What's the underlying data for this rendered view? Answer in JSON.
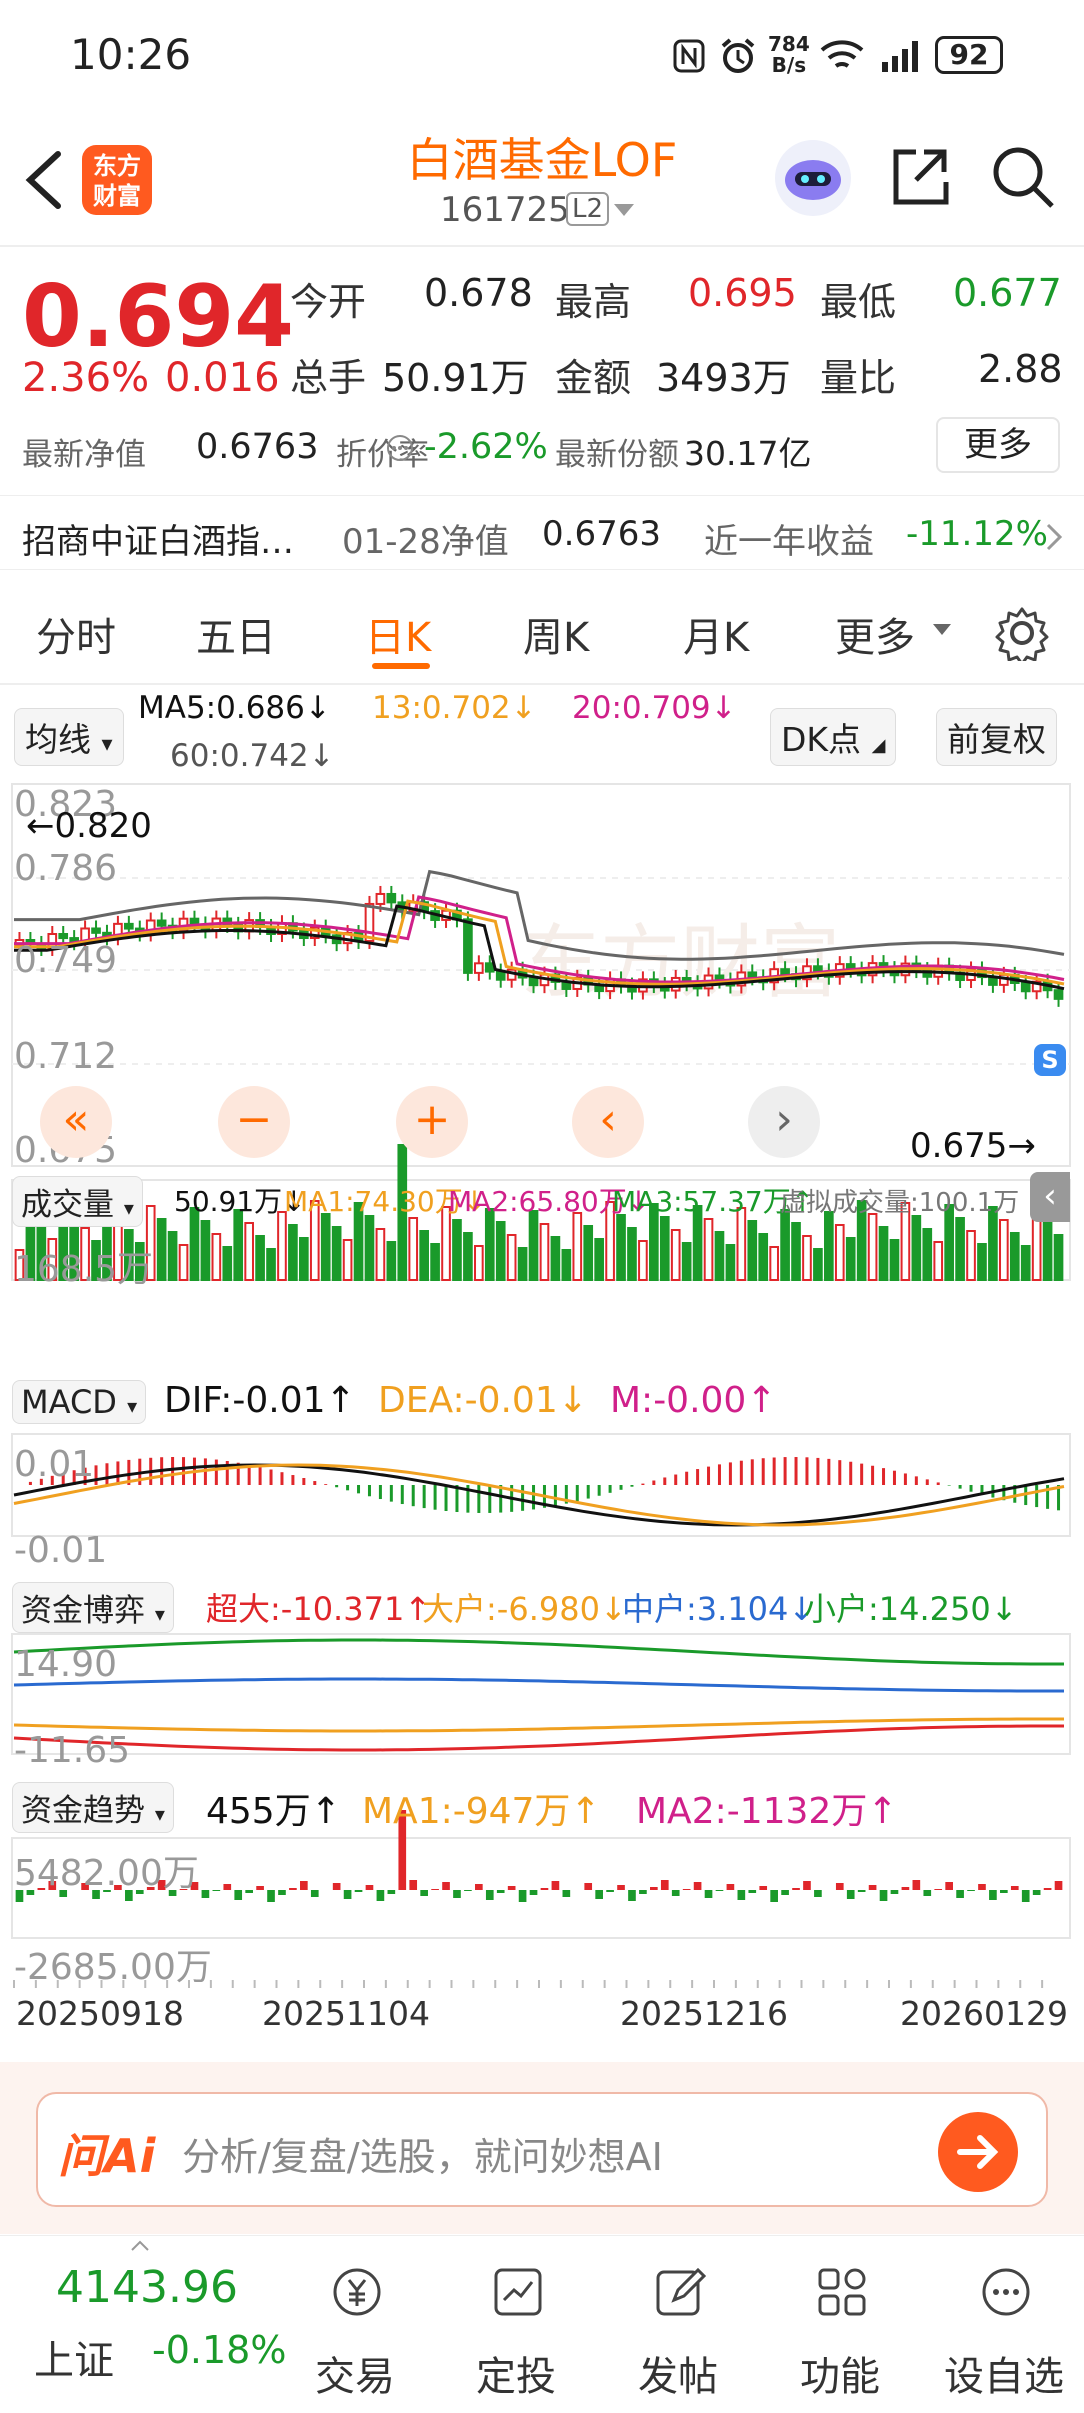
{
  "status": {
    "time": "10:26",
    "net_speed_top": "784",
    "net_speed_bottom": "B/s",
    "battery": "92"
  },
  "header": {
    "logo_line1": "东方",
    "logo_line2": "财富",
    "title": "白酒基金LOF",
    "code": "161725",
    "level": "L2"
  },
  "quote": {
    "price": "0.694",
    "change_pct": "2.36%",
    "change": "0.016",
    "open_label": "今开",
    "open": "0.678",
    "high_label": "最高",
    "high": "0.695",
    "low_label": "最低",
    "low": "0.677",
    "volume_label": "总手",
    "volume": "50.91万",
    "amount_label": "金额",
    "amount": "3493万",
    "ratio_label": "量比",
    "ratio": "2.88",
    "nav_label": "最新净值",
    "nav": "0.6763",
    "discount_label": "折价率",
    "discount": "-2.62%",
    "shares_label": "最新份额",
    "shares": "30.17亿",
    "more": "更多"
  },
  "fundinfo": {
    "name": "招商中证白酒指…",
    "date_nav_label": "01-28净值",
    "date_nav": "0.6763",
    "year_label": "近一年收益",
    "year_return": "-11.12%"
  },
  "tabs": [
    "分时",
    "五日",
    "日K",
    "周K",
    "月K",
    "更多"
  ],
  "active_tab": "日K",
  "chart_toolbar": {
    "ma_select": "均线",
    "ma5": "MA5:0.686↓",
    "ma13": "13:0.702↓",
    "ma20": "20:0.709↓",
    "ma60": "60:0.742↓",
    "dk": "DK点",
    "adjust": "前复权"
  },
  "kline": {
    "y_labels": [
      "0.823",
      "0.786",
      "0.749",
      "0.712",
      "0.675"
    ],
    "high_marker": "0.820",
    "low_marker": "0.675"
  },
  "volume_panel": {
    "select": "成交量",
    "vol": "50.91万↓",
    "ma1": "MA1:74.30万↓",
    "ma2": "MA2:65.80万↓",
    "ma3": "MA3:57.37万↑",
    "virtual": "虚拟成交量:100.1万",
    "max": "168.5万"
  },
  "macd_panel": {
    "select": "MACD",
    "dif": "DIF:-0.01↑",
    "dea": "DEA:-0.01↓",
    "m": "M:-0.00↑",
    "top": "0.01",
    "bottom": "-0.01"
  },
  "fund_game_panel": {
    "select": "资金博弈",
    "super": "超大:-10.371↑",
    "large": "大户:-6.980↓",
    "mid": "中户:3.104↓",
    "small": "小户:14.250↓",
    "top": "14.90",
    "bottom": "-11.65"
  },
  "fund_trend_panel": {
    "select": "资金趋势",
    "value": "455万↑",
    "ma1": "MA1:-947万↑",
    "ma2": "MA2:-1132万↑",
    "top": "5482.00万",
    "bottom": "-2685.00万"
  },
  "dates": [
    "20250918",
    "20251104",
    "20251216",
    "20260129"
  ],
  "ai_bar": {
    "logo": "问Ai",
    "placeholder": "分析/复盘/选股，就问妙想AI"
  },
  "bottom_nav": {
    "index_value": "4143.96",
    "index_name": "上证",
    "index_change": "-0.18%",
    "items": [
      "交易",
      "定投",
      "发帖",
      "功能",
      "设自选"
    ]
  },
  "colors": {
    "up": "#e0262a",
    "down": "#1a9a2a",
    "accent": "#ff6a00",
    "ma5": "#111111",
    "ma13": "#f0a020",
    "ma20": "#d0208a",
    "ma60": "#666666"
  }
}
